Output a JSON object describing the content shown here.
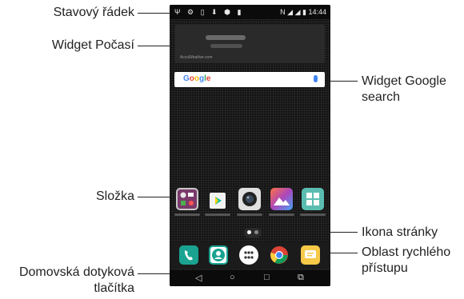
{
  "callouts": {
    "status_bar": "Stavový řádek",
    "weather_widget": "Widget Počasí",
    "google_widget_line1": "Widget Google",
    "google_widget_line2": "search",
    "folder": "Složka",
    "page_icon": "Ikona stránky",
    "quick_access_line1": "Oblast rychlého",
    "quick_access_line2": "přístupu",
    "home_keys_line1": "Domovská dotyková",
    "home_keys_line2": "tlačítka"
  },
  "phone": {
    "status_bar": {
      "left_icons": [
        "usb-icon",
        "alarm-icon",
        "sim-icon",
        "download-icon",
        "shield-icon",
        "battery-saver-icon"
      ],
      "time": "14:44"
    },
    "weather_widget": {
      "credit": "AccuWeather.com"
    },
    "google_search": {
      "logo": "Google",
      "mic_icon": "mic-icon"
    },
    "apps": [
      "folder",
      "play-store",
      "camera",
      "gallery",
      "calculator-grid"
    ],
    "dock": [
      "phone",
      "contacts",
      "apps-drawer",
      "chrome",
      "messages"
    ],
    "nav": {
      "back": "◁",
      "home": "○",
      "recents": "□",
      "dual": "⧉"
    }
  }
}
